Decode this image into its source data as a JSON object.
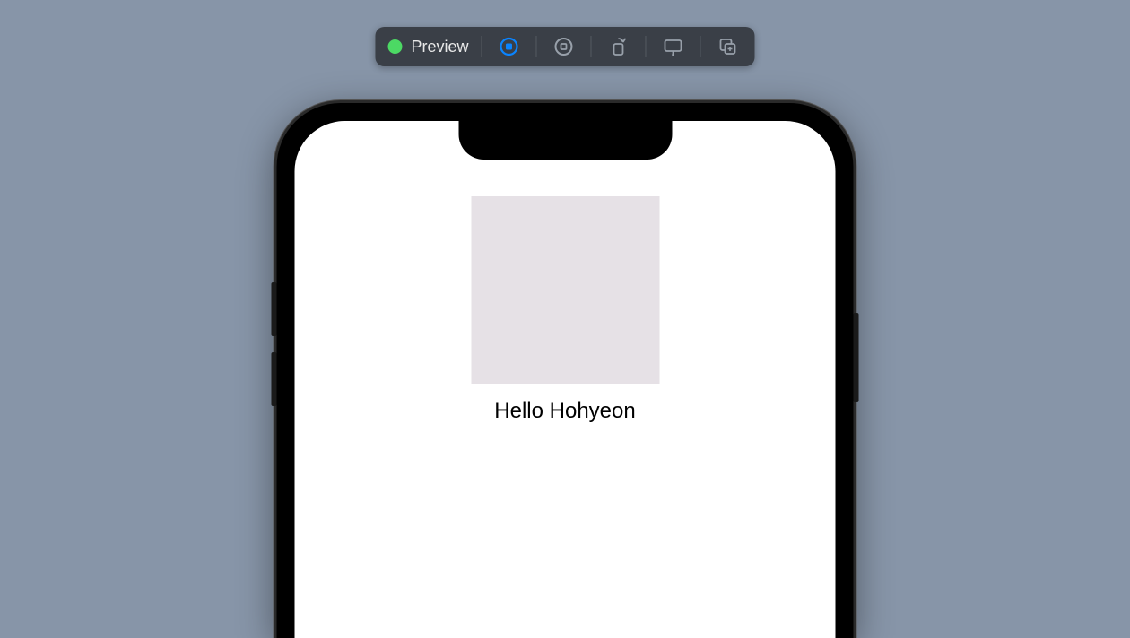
{
  "toolbar": {
    "status": {
      "color": "#4cd964"
    },
    "preview_label": "Preview"
  },
  "app": {
    "greeting_text": "Hello Hohyeon"
  }
}
